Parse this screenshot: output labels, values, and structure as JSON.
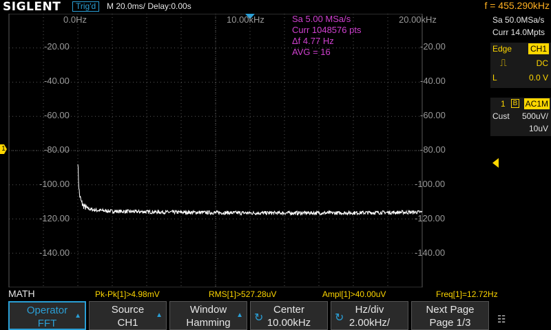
{
  "header": {
    "brand": "SIGLENT",
    "trigger_status": "Trig'd",
    "timebase": "M 20.0ms/ Delay:0.00s",
    "frequency": "f = 455.290kHz"
  },
  "plot": {
    "x_labels": [
      "0.0Hz",
      "10.00kHz",
      "20.00kHz"
    ],
    "y_labels": [
      "-20.00",
      "-40.00",
      "-60.00",
      "-80.00",
      "-100.00",
      "-120.00",
      "-140.00"
    ],
    "fft_info": [
      "Sa 5.00 MSa/s",
      "Curr 1048576 pts",
      "Δf 4.77 Hz",
      "AVG = 16"
    ],
    "ch_marker": "1"
  },
  "chart_data": {
    "type": "line",
    "x_unit": "Hz",
    "y_unit": "dBV",
    "xlim": [
      0,
      20000
    ],
    "ylim": [
      -160,
      0
    ],
    "series": [
      {
        "x": [
          0,
          50,
          100,
          200,
          300,
          500,
          800,
          1200,
          2000,
          5000,
          10000,
          15000,
          20000
        ],
        "values": [
          -86,
          -100,
          -106,
          -110,
          -112,
          -113.5,
          -114.5,
          -115,
          -115.5,
          -116,
          -116.5,
          -116.5,
          -116
        ]
      }
    ]
  },
  "right_panel": {
    "sample_rate": "Sa 50.0MSa/s",
    "memory": "Curr 14.0Mpts",
    "trigger_type": "Edge",
    "trigger_source": "CH1",
    "trigger_coupling": "DC",
    "trigger_level_label": "L",
    "trigger_level": "0.0 V",
    "channel_number": "1",
    "bandwidth_flag": "B",
    "channel_coupling": "AC1M",
    "cust_label": "Cust",
    "vdiv": "500uV/",
    "probe": "10uV"
  },
  "measurements": {
    "label": "MATH",
    "items": [
      "Pk-Pk[1]>4.98mV",
      "RMS[1]>527.28uV",
      "Ampl[1]>40.00uV",
      "Freq[1]=12.72Hz"
    ]
  },
  "menu": {
    "softkeys": [
      {
        "line1": "Operator",
        "line2": "FFT"
      },
      {
        "line1": "Source",
        "line2": "CH1"
      },
      {
        "line1": "Window",
        "line2": "Hamming"
      },
      {
        "line1": "Center",
        "line2": "10.00kHz"
      },
      {
        "line1": "Hz/div",
        "line2": "2.00kHz/"
      },
      {
        "line1": "Next Page",
        "line2": "Page 1/3"
      }
    ]
  },
  "colors": {
    "trace": "#ffffff",
    "grid": "#5a5a5a",
    "channel1": "#ffd700",
    "accent": "#2a9fd6",
    "math_info": "#d040d0",
    "frequency": "#ffb020"
  },
  "icons": [
    "network-icon",
    "rotary-knob-icon",
    "menu-arrow-icon",
    "edge-rising-icon"
  ]
}
